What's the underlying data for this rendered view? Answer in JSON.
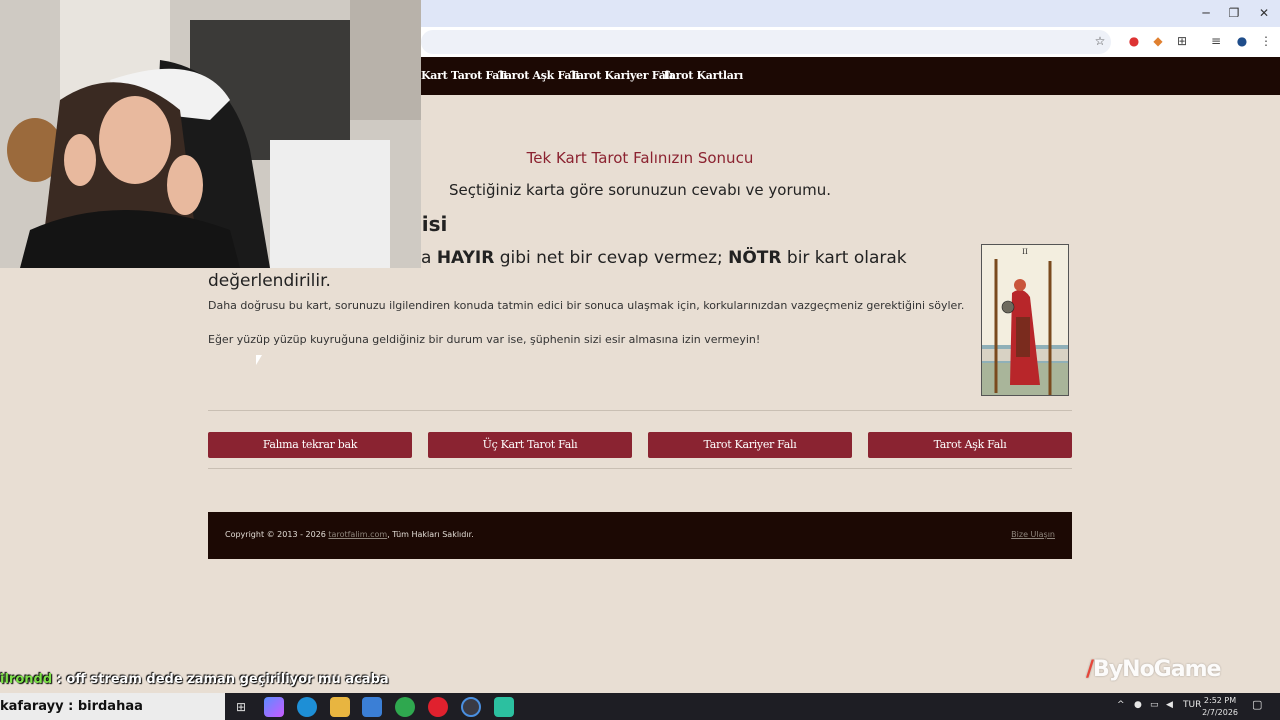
{
  "browser": {
    "window_controls": {
      "minimize": "─",
      "restore": "❐",
      "close": "✕"
    }
  },
  "nav": {
    "items": [
      "Kart Tarot Falı",
      "Tarot Aşk Falı",
      "Tarot Kariyer Falı",
      "Tarot Kartları"
    ]
  },
  "result": {
    "title": "Tek Kart Tarot Falınızın Sonucu",
    "subtitle": "Seçtiğiniz karta göre sorunuzun cevabı ve yorumu.",
    "card_name_partial": "ilisi",
    "verdict_pre": "a",
    "verdict_hayir": "HAYIR",
    "verdict_mid": " gibi net bir cevap vermez; ",
    "verdict_notr": "NÖTR",
    "verdict_post": " bir kart olarak",
    "verdict_line2": "değerlendirilir.",
    "para1": "Daha doğrusu bu kart, sorunuzu ilgilendiren konuda tatmin edici bir sonuca ulaşmak için, korkularınızdan vazgeçmeniz gerektiğini söyler.",
    "para2": "Eğer yüzüp yüzüp kuyruğuna geldiğiniz bir durum var ise, şüphenin sizi esir almasına izin vermeyin!",
    "card_numeral": "II"
  },
  "actions": [
    "Falıma tekrar bak",
    "Üç Kart Tarot Falı",
    "Tarot Kariyer Falı",
    "Tarot Aşk Falı"
  ],
  "footer": {
    "copy_pre": "Copyright © 2013 - 2026 ",
    "copy_link": "tarotfalim.com",
    "copy_post": ", Tüm Hakları Saklıdır.",
    "contact": "Bize Ulaşın"
  },
  "overlay": {
    "chat_user": "ilrondd",
    "chat_message": " : off stream dede zaman geçiriliyor mu acaba",
    "bottom_chat": "kafarayy : birdahaa",
    "brand_mark": "/",
    "brand_text": "ByNoGame"
  },
  "taskbar": {
    "lang": "TUR",
    "time": "2:52 PM",
    "date": "2/7/2026"
  }
}
